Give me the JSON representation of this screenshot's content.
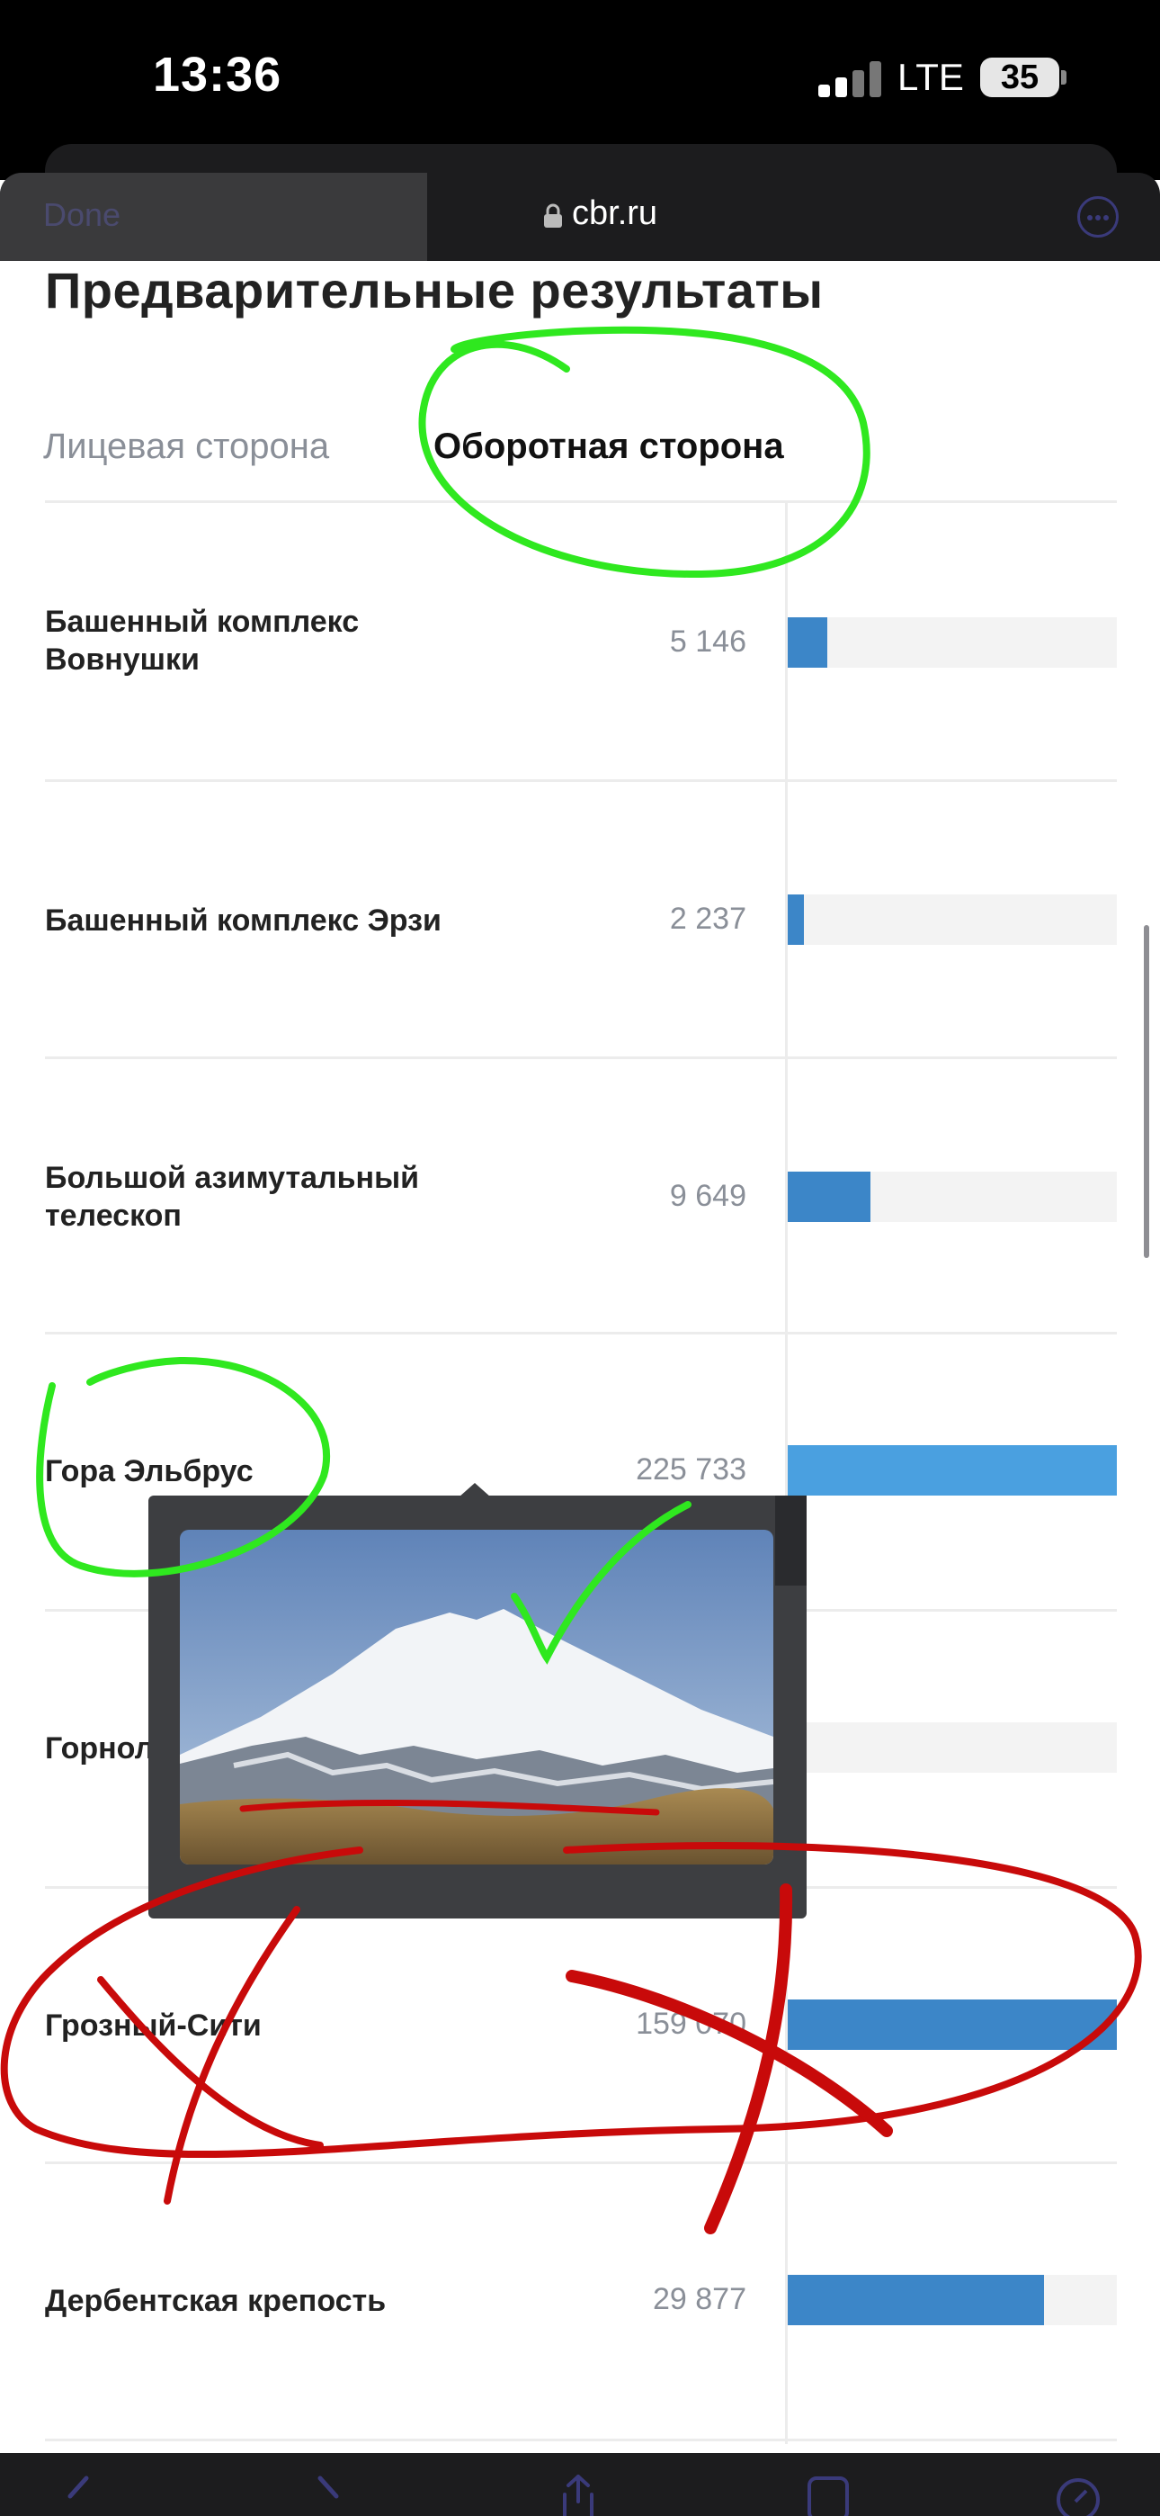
{
  "status_bar": {
    "time": "13:36",
    "network": "LTE",
    "battery": "35"
  },
  "browser": {
    "done_label": "Done",
    "url": "cbr.ru"
  },
  "page": {
    "title": "Предварительные результаты",
    "tabs": [
      {
        "label": "Лицевая сторона",
        "active": false
      },
      {
        "label": "Оборотная сторона",
        "active": true
      }
    ]
  },
  "results": [
    {
      "name": "Башенный комплекс Вовнушки",
      "count": "5 146",
      "share": 0.12
    },
    {
      "name": "Башенный комплекс Эрзи",
      "count": "2 237",
      "share": 0.05
    },
    {
      "name": "Большой азимутальный телескоп",
      "count": "9 649",
      "share": 0.25
    },
    {
      "name": "Гора Эльбрус",
      "count": "225 733",
      "share": 1.0
    },
    {
      "name": "Горнолы",
      "count": "",
      "share": 0.02
    },
    {
      "name": "Грозный-Сити",
      "count": "159 070",
      "share": 1.0
    },
    {
      "name": "Дербентская крепость",
      "count": "29 877",
      "share": 0.78
    }
  ],
  "popup": {
    "image": "mount-elbrus-photo"
  },
  "colors": {
    "bar": "#3c86c8",
    "bar_highlight": "#4aa0e0",
    "annotation_green": "#2fe81f",
    "annotation_red": "#c80a0a"
  }
}
